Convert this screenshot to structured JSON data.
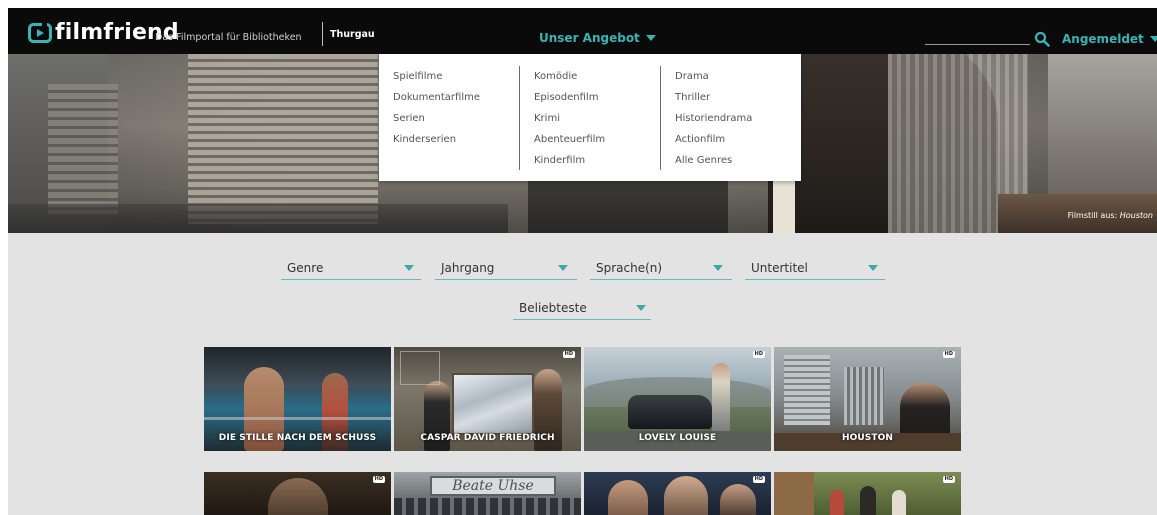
{
  "header": {
    "logo_text": "filmfriend",
    "tagline": "Das Filmportal für Bibliotheken",
    "library": "Thurgau",
    "offer_label": "Unser Angebot",
    "search_placeholder": "",
    "account_label": "Angemeldet",
    "accent_color": "#39b3b3"
  },
  "mega_menu": {
    "col1": [
      "Spielfilme",
      "Dokumentarfilme",
      "Serien",
      "Kinderserien"
    ],
    "col2": [
      "Komödie",
      "Episodenfilm",
      "Krimi",
      "Abenteuerfilm",
      "Kinderfilm"
    ],
    "col3": [
      "Drama",
      "Thriller",
      "Historiendrama",
      "Actionfilm",
      "Alle Genres"
    ]
  },
  "hero": {
    "caption_prefix": "Filmstill aus:",
    "caption_title": "Houston"
  },
  "filters": {
    "genre": "Genre",
    "year": "Jahrgang",
    "language": "Sprache(n)",
    "subtitles": "Untertitel",
    "sort": "Beliebteste"
  },
  "movies_row1": [
    {
      "title": "DIE STILLE NACH DEM SCHUSS",
      "hd": ""
    },
    {
      "title": "CASPAR DAVID FRIEDRICH",
      "hd": "HD"
    },
    {
      "title": "LOVELY LOUISE",
      "hd": "HD"
    },
    {
      "title": "HOUSTON",
      "hd": "HD"
    }
  ],
  "movies_row2": [
    {
      "title": "",
      "hd": "HD"
    },
    {
      "title": "",
      "hd": ""
    },
    {
      "title": "",
      "hd": "HD"
    },
    {
      "title": "",
      "hd": "HD"
    }
  ],
  "row2_sign_text": "Beate Uhse"
}
